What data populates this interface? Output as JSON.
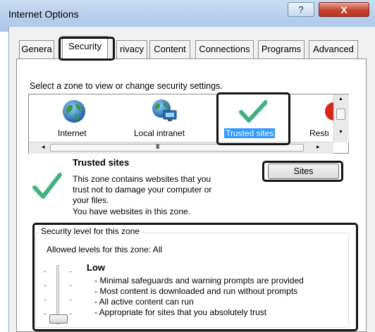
{
  "window": {
    "title": "Internet Options",
    "help_label": "?",
    "close_label": "X"
  },
  "tabs": [
    {
      "label": "Genera"
    },
    {
      "label": "Security"
    },
    {
      "label": "rivacy"
    },
    {
      "label": "Content"
    },
    {
      "label": "Connections"
    },
    {
      "label": "Programs"
    },
    {
      "label": "Advanced"
    }
  ],
  "security": {
    "instruction": "Select a zone to view or change security settings.",
    "zones": [
      {
        "label": "Internet",
        "icon": "globe-icon"
      },
      {
        "label": "Local intranet",
        "icon": "intranet-globe-icon"
      },
      {
        "label": "Trusted sites",
        "icon": "checkmark-icon",
        "selected": true
      },
      {
        "label": "Restı",
        "icon": "restricted-icon"
      }
    ],
    "scroll_glyph": "III",
    "zone_detail": {
      "title": "Trusted sites",
      "description_lines": [
        "This zone contains websites that you",
        "trust not to damage your computer or",
        "your files.",
        "You have websites in this zone."
      ],
      "sites_button": "Sites"
    },
    "level_group": {
      "title": "Security level for this zone",
      "allowed": "Allowed levels for this zone: All",
      "level_name": "Low",
      "bullets": [
        "- Minimal safeguards and warning prompts are provided",
        "- Most content is downloaded and run without prompts",
        "- All active content can run",
        "- Appropriate for sites that you absolutely trust"
      ]
    }
  },
  "colors": {
    "accent": "#3399ff",
    "check_green": "#3fb27f",
    "highlight_frame": "#141414"
  }
}
